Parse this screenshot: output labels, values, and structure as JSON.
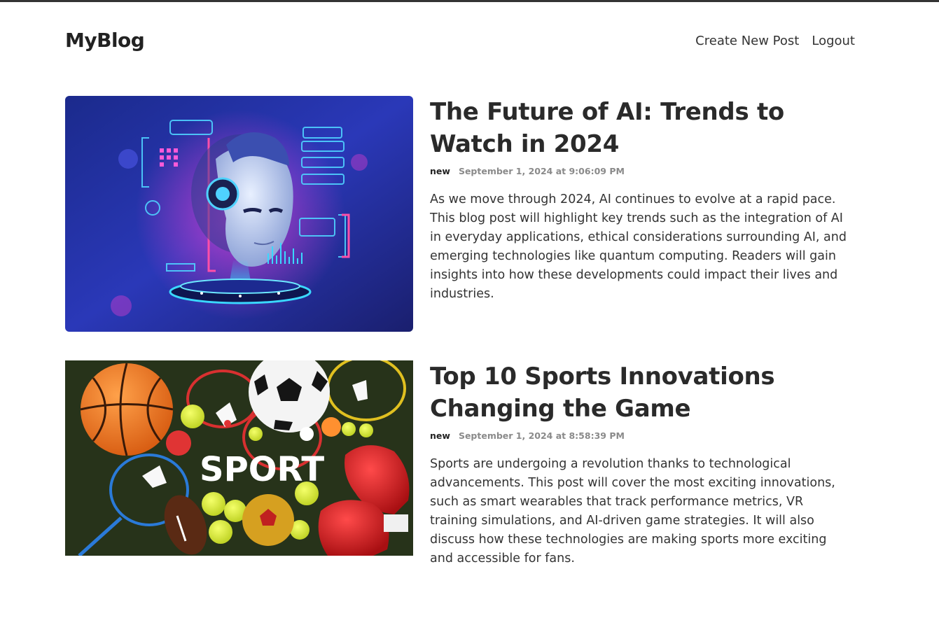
{
  "header": {
    "logo": "MyBlog",
    "nav": {
      "create_label": "Create New Post",
      "logout_label": "Logout"
    }
  },
  "posts": [
    {
      "title": "The Future of AI: Trends to Watch in 2024",
      "author": "new",
      "date": "September 1, 2024 at 9:06:09 PM",
      "excerpt": "As we move through 2024, AI continues to evolve at a rapid pace. This blog post will highlight key trends such as the integration of AI in everyday applications, ethical considerations surrounding AI, and emerging technologies like quantum computing. Readers will gain insights into how these developments could impact their lives and industries.",
      "image_text": ""
    },
    {
      "title": "Top 10 Sports Innovations Changing the Game",
      "author": "new",
      "date": "September 1, 2024 at 8:58:39 PM",
      "excerpt": "Sports are undergoing a revolution thanks to technological advancements. This post will cover the most exciting innovations, such as smart wearables that track performance metrics, VR training simulations, and AI-driven game strategies. It will also discuss how these technologies are making sports more exciting and accessible for fans.",
      "image_text": "SPORT"
    }
  ],
  "colors": {
    "text": "#222222",
    "meta_date": "#8a8a8a",
    "top_border": "#333333"
  }
}
